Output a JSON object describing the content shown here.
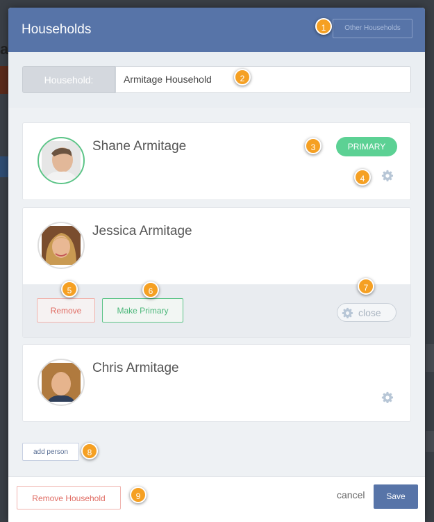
{
  "header": {
    "title": "Households",
    "other_households_label": "Other Households"
  },
  "household": {
    "label": "Household:",
    "value": "Armitage Household"
  },
  "members": [
    {
      "name": "Shane Armitage",
      "badge": "PRIMARY",
      "gear_icon": "gear-icon"
    },
    {
      "name": "Jessica Armitage",
      "remove_label": "Remove",
      "make_primary_label": "Make Primary",
      "close_label": "close"
    },
    {
      "name": "Chris Armitage",
      "gear_icon": "gear-icon"
    }
  ],
  "add_person_label": "add person",
  "footer": {
    "remove_household_label": "Remove Household",
    "cancel_label": "cancel",
    "save_label": "Save"
  },
  "callouts": [
    "1",
    "2",
    "3",
    "4",
    "5",
    "6",
    "7",
    "8",
    "9"
  ],
  "colors": {
    "header_bg": "#5774a8",
    "primary_green": "#5cd194",
    "danger_red": "#e06c63",
    "callout_orange": "#f5a023"
  }
}
